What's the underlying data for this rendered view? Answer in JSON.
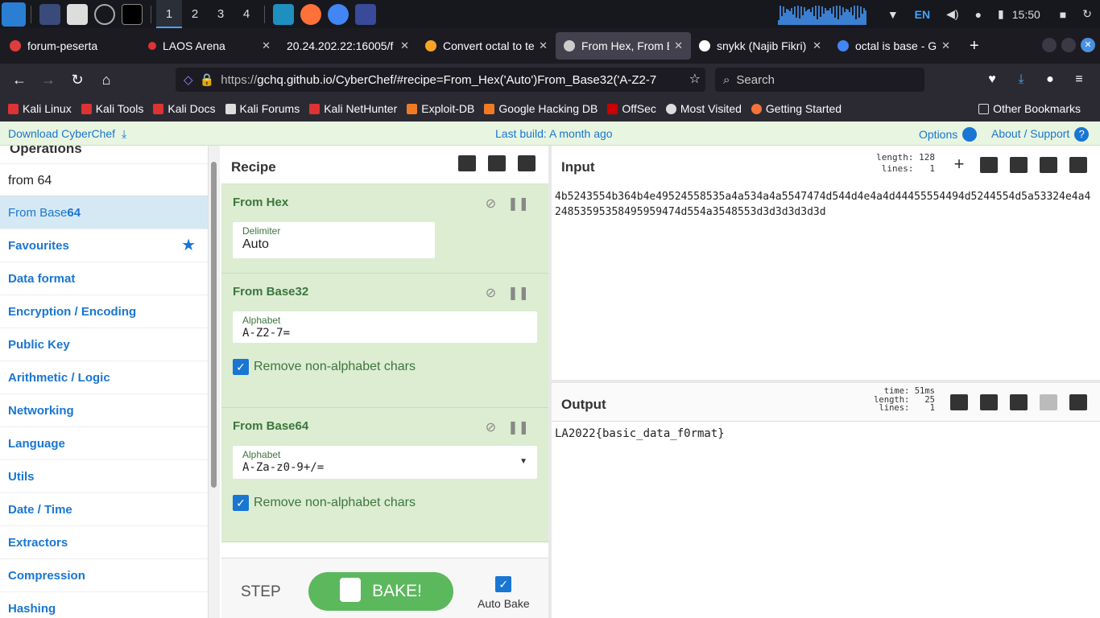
{
  "taskbar": {
    "workspaces": [
      "1",
      "2",
      "3",
      "4"
    ],
    "lang": "EN",
    "clock": "15:50"
  },
  "tabs": [
    {
      "title": "forum-peserta",
      "color": "#e03c3c"
    },
    {
      "title": "LAOS Arena",
      "color": "#d33"
    },
    {
      "title": "20.24.202.22:16005/f",
      "color": "#888"
    },
    {
      "title": "Convert octal to te",
      "color": "#f5a623"
    },
    {
      "title": "From Hex, From B",
      "color": "#ccc"
    },
    {
      "title": "snykk (Najib Fikri)",
      "color": "#fff"
    },
    {
      "title": "octal is base - Goo",
      "color": "#4285f4"
    }
  ],
  "nav": {
    "url_prefix": "https://",
    "url": "gchq.github.io/CyberChef/#recipe=From_Hex('Auto')From_Base32('A-Z2-7",
    "search_placeholder": "Search"
  },
  "bookmarks": [
    {
      "label": "Kali Linux",
      "color": "#d33"
    },
    {
      "label": "Kali Tools",
      "color": "#d33"
    },
    {
      "label": "Kali Docs",
      "color": "#d33"
    },
    {
      "label": "Kali Forums",
      "color": "#ddd"
    },
    {
      "label": "Kali NetHunter",
      "color": "#d33"
    },
    {
      "label": "Exploit-DB",
      "color": "#f07b24"
    },
    {
      "label": "Google Hacking DB",
      "color": "#f07b24"
    },
    {
      "label": "OffSec",
      "color": "#c00"
    },
    {
      "label": "Most Visited",
      "color": "#ddd"
    },
    {
      "label": "Getting Started",
      "color": "#f5733a"
    }
  ],
  "bookmarks_other": "Other Bookmarks",
  "banner": {
    "download": "Download CyberChef",
    "last_build": "Last build: A month ago",
    "options": "Options",
    "support": "About / Support"
  },
  "operations": {
    "title": "Operations",
    "search_value": "from 64",
    "highlight_prefix": "From Base",
    "highlight_match": "64",
    "categories": [
      "Favourites",
      "Data format",
      "Encryption / Encoding",
      "Public Key",
      "Arithmetic / Logic",
      "Networking",
      "Language",
      "Utils",
      "Date / Time",
      "Extractors",
      "Compression",
      "Hashing"
    ]
  },
  "recipe": {
    "title": "Recipe",
    "ops": [
      {
        "name": "From Hex",
        "fields": [
          {
            "label": "Delimiter",
            "value": "Auto"
          }
        ],
        "checkbox": null
      },
      {
        "name": "From Base32",
        "fields": [
          {
            "label": "Alphabet",
            "value": "A-Z2-7="
          }
        ],
        "checkbox": "Remove non-alphabet chars"
      },
      {
        "name": "From Base64",
        "fields": [
          {
            "label": "Alphabet",
            "value": "A-Za-z0-9+/="
          }
        ],
        "checkbox": "Remove non-alphabet chars"
      }
    ],
    "step": "STEP",
    "bake": "BAKE!",
    "auto_bake": "Auto Bake"
  },
  "input": {
    "title": "Input",
    "length_label": "length:",
    "length": "128",
    "lines_label": "lines:",
    "lines": "1",
    "text": "4b5243554b364b4e49524558535a4a534a4a5547474d544d4e4a4d44455554494d5244554d5a53324e4a424853595358495959474d554a3548553d3d3d3d3d3d"
  },
  "output": {
    "title": "Output",
    "time_label": "time:",
    "time": "51ms",
    "length_label": "length:",
    "length": "25",
    "lines_label": "lines:",
    "lines": "1",
    "text": "LA2022{basic_data_f0rmat}"
  }
}
